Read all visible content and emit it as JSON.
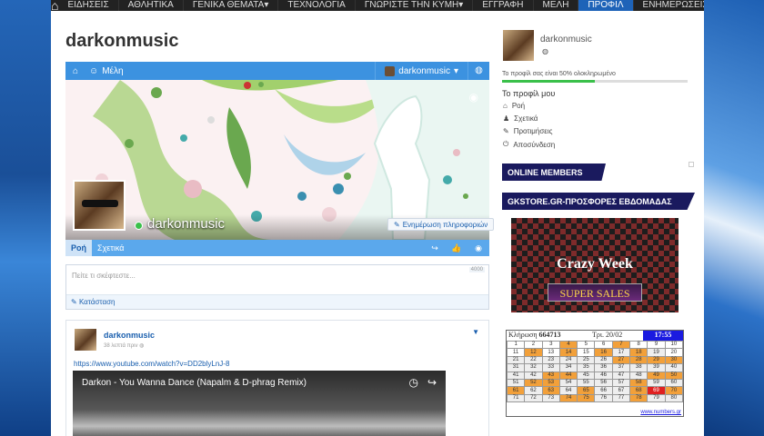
{
  "nav": {
    "items": [
      {
        "label": "ΕΙΔΗΣΕΙΣ",
        "active": false,
        "caret": false
      },
      {
        "label": "ΑΘΛΗΤΙΚΑ",
        "active": false,
        "caret": false
      },
      {
        "label": "ΓΕΝΙΚΑ ΘΕΜΑΤΑ",
        "active": false,
        "caret": true
      },
      {
        "label": "ΤΕΧΝΟΛΟΓΙΑ",
        "active": false,
        "caret": false
      },
      {
        "label": "ΓΝΩΡΙΣΤΕ ΤΗΝ ΚΥΜΗ",
        "active": false,
        "caret": true
      },
      {
        "label": "ΕΓΓΡΑΦΗ",
        "active": false,
        "caret": false
      },
      {
        "label": "ΜΕΛΗ",
        "active": false,
        "caret": false
      },
      {
        "label": "ΠΡΟΦΙΛ",
        "active": true,
        "caret": false
      },
      {
        "label": "ΕΝΗΜΕΡΩΣΕΙΣ",
        "active": false,
        "caret": false
      }
    ]
  },
  "profile": {
    "title": "darkonmusic",
    "members_label": "Μέλη",
    "username": "darkonmusic",
    "update_label": "Ενημέρωση πληροφοριών",
    "tabs": [
      "Ροή",
      "Σχετικά"
    ]
  },
  "composer": {
    "placeholder": "Πείτε τι σκέφτεστε...",
    "counter": "4000",
    "status_label": "Κατάσταση"
  },
  "post": {
    "author": "darkonmusic",
    "time": "38 λεπτά πριν",
    "link": "https://www.youtube.com/watch?v=DD2blyLnJ-8",
    "video_title": "Darkon - You Wanna Dance (Napalm & D-phrag Remix)"
  },
  "sidebar": {
    "username": "darkonmusic",
    "completeness": "Το προφίλ σας είναι 50% ολοκληρωμένο",
    "completeness_pct": 50,
    "menu_title": "Το προφίλ μου",
    "menu": [
      {
        "icon": "home-icon",
        "glyph": "⌂",
        "label": "Ροή"
      },
      {
        "icon": "user-icon",
        "glyph": "♟",
        "label": "Σχετικά"
      },
      {
        "icon": "edit-icon",
        "glyph": "✎",
        "label": "Προτιμήσεις"
      },
      {
        "icon": "power-icon",
        "glyph": "⏻",
        "label": "Αποσύνδεση"
      }
    ],
    "online_header": "ONLINE MEMBERS",
    "store_header": "GKSTORE.GR-ΠΡΟΣΦΟΡΕΣ ΕΒΔΟΜΑΔΑΣ",
    "promo_line1": "Crazy Week",
    "promo_line2": "SUPER SALES"
  },
  "lotto": {
    "draw_label": "Κλήρωση",
    "draw_number": "664713",
    "date": "Τρι. 20/02",
    "time": "17:55",
    "footer": "www.numbers.gr",
    "orange": [
      4,
      7,
      12,
      14,
      16,
      18,
      27,
      28,
      29,
      30,
      43,
      44,
      49,
      50,
      52,
      53,
      58,
      61,
      63,
      65,
      68,
      70,
      74,
      75,
      78
    ],
    "red": [
      69
    ],
    "dim": [
      17,
      19,
      21,
      22,
      23,
      24,
      25,
      26,
      31,
      32,
      33,
      34,
      35,
      36,
      37,
      38,
      39,
      40,
      41,
      42,
      45,
      46,
      47,
      48,
      51,
      54,
      55,
      56,
      57,
      59,
      60,
      62,
      64,
      66,
      67,
      71,
      72,
      73,
      76,
      77,
      79,
      80
    ]
  }
}
